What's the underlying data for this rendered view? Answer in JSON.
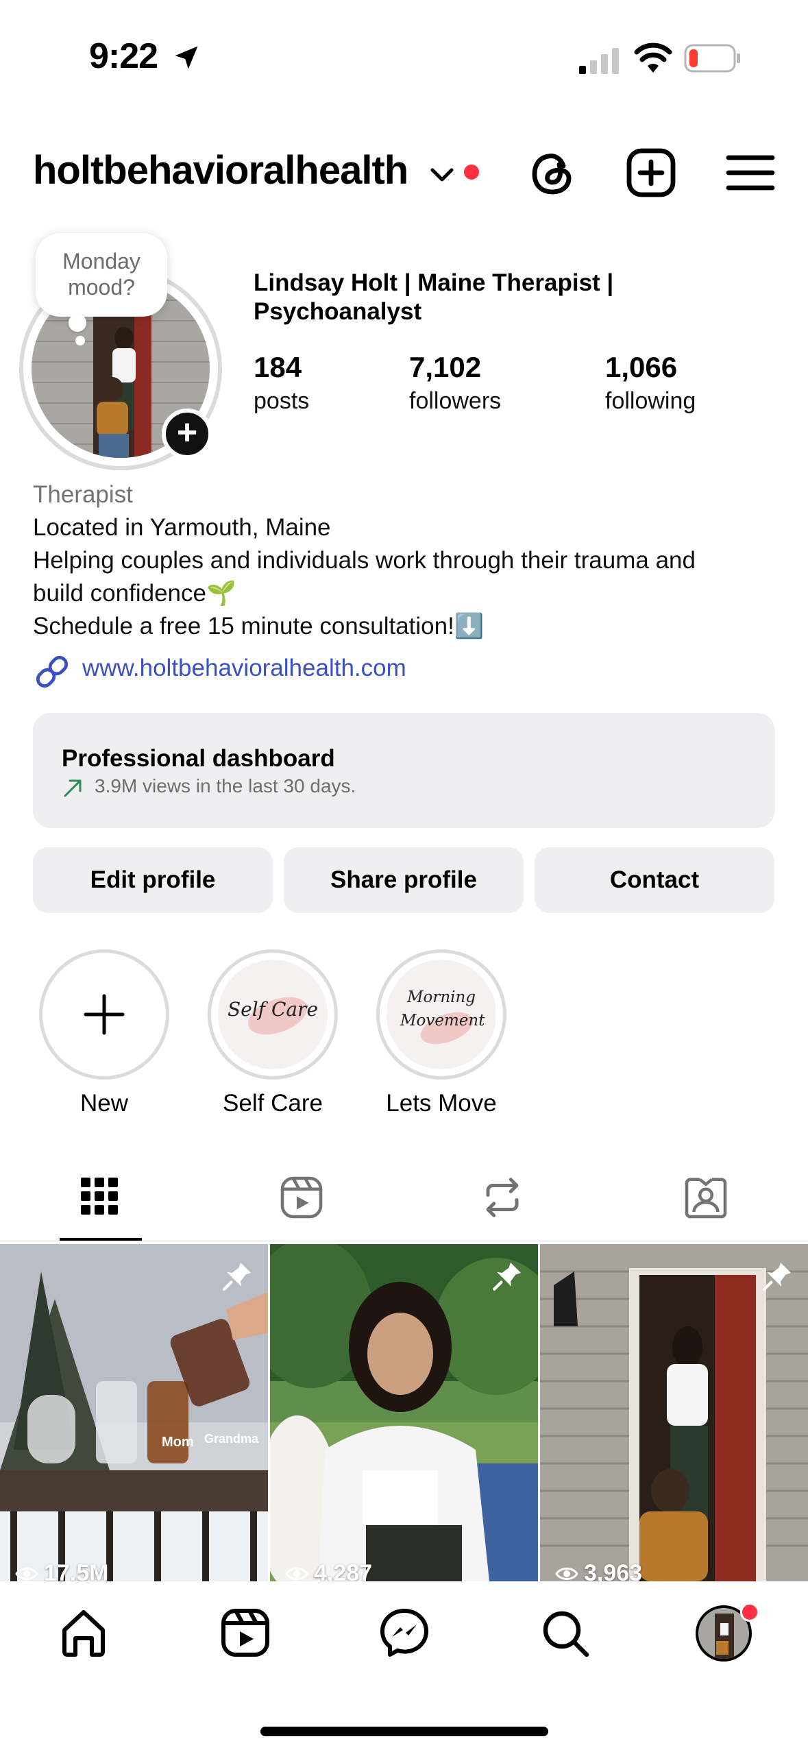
{
  "status_bar": {
    "time": "9:22"
  },
  "header": {
    "username": "holtbehavioralhealth"
  },
  "profile": {
    "note": "Monday mood?",
    "full_name": "Lindsay Holt | Maine Therapist | Psychoanalyst",
    "stats": [
      {
        "value": "184",
        "label": "posts"
      },
      {
        "value": "7,102",
        "label": "followers"
      },
      {
        "value": "1,066",
        "label": "following"
      }
    ],
    "category": "Therapist",
    "bio_lines": [
      "Located in Yarmouth, Maine",
      "Helping couples and individuals work through their trauma and",
      "build confidence🌱",
      "Schedule a free 15 minute consultation!⬇️"
    ],
    "link": "www.holtbehavioralhealth.com"
  },
  "dashboard": {
    "title": "Professional dashboard",
    "subtitle": "3.9M views in the last 30 days."
  },
  "buttons": {
    "edit": "Edit profile",
    "share": "Share profile",
    "contact": "Contact"
  },
  "highlights": [
    {
      "label": "New",
      "cover_text": ""
    },
    {
      "label": "Self Care",
      "cover_text": "Self Care"
    },
    {
      "label": "Lets Move",
      "cover_text": "Morning Movement"
    }
  ],
  "grid": [
    {
      "views": "17.5M",
      "overlay": [
        "Mom",
        "Grandma"
      ]
    },
    {
      "views": "4,287"
    },
    {
      "views": "3,963"
    }
  ],
  "colors": {
    "link": "#3b4fc4",
    "notification": "#ff3040",
    "trend": "#2e8b57"
  }
}
